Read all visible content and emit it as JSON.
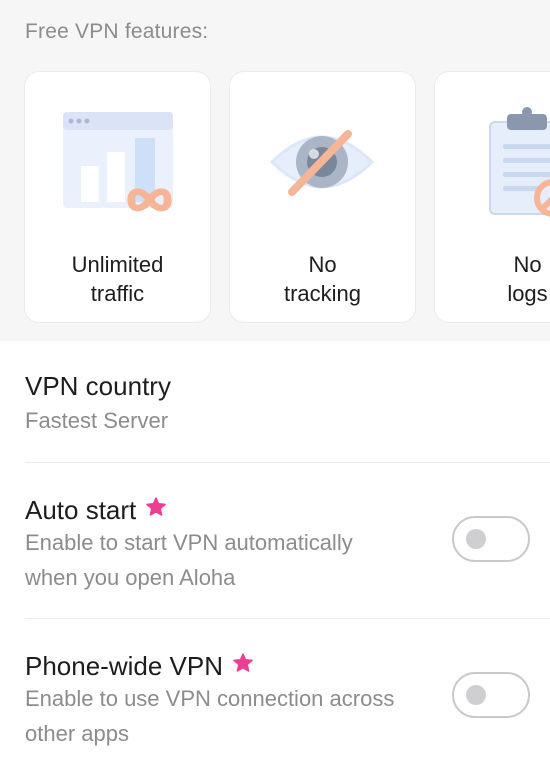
{
  "features": {
    "title": "Free VPN features:",
    "cards": [
      {
        "line1": "Unlimited",
        "line2": "traffic",
        "icon": "unlimited-traffic-icon"
      },
      {
        "line1": "No",
        "line2": "tracking",
        "icon": "no-tracking-icon"
      },
      {
        "line1": "No",
        "line2": "logs",
        "icon": "no-logs-icon"
      }
    ]
  },
  "settings": {
    "vpn_country": {
      "title": "VPN country",
      "value": "Fastest Server"
    },
    "auto_start": {
      "title": "Auto start",
      "desc_line1": "Enable to start VPN automatically",
      "desc_line2": "when you open Aloha",
      "enabled": false,
      "premium_icon": "star-icon"
    },
    "phone_wide": {
      "title": "Phone-wide VPN",
      "desc_line1": "Enable to use VPN connection across",
      "desc_line2": "other apps",
      "enabled": false,
      "premium_icon": "star-icon"
    }
  },
  "colors": {
    "accent_star": "#ec3f93",
    "illustration_orange": "#f6b596",
    "illustration_blue": "#e6eefb"
  }
}
